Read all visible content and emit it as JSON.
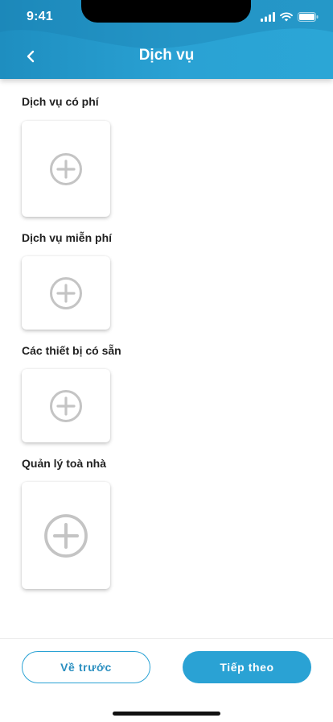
{
  "status_bar": {
    "time": "9:41",
    "icons": [
      "signal-icon",
      "wifi-icon",
      "battery-icon"
    ]
  },
  "header": {
    "title": "Dịch vụ",
    "back_icon": "chevron-left-icon"
  },
  "sections": [
    {
      "label": "Dịch vụ có phí",
      "add_icon": "plus-circle-icon"
    },
    {
      "label": "Dịch vụ miễn phí",
      "add_icon": "plus-circle-icon"
    },
    {
      "label": "Các thiết bị có sẵn",
      "add_icon": "plus-circle-icon"
    },
    {
      "label": "Quản lý toà nhà",
      "add_icon": "plus-circle-icon"
    }
  ],
  "footer": {
    "back_label": "Về trước",
    "next_label": "Tiếp theo"
  },
  "colors": {
    "accent": "#2aa2d4",
    "header_dark": "#1e8ec0",
    "icon_gray": "#c4c4c4"
  }
}
